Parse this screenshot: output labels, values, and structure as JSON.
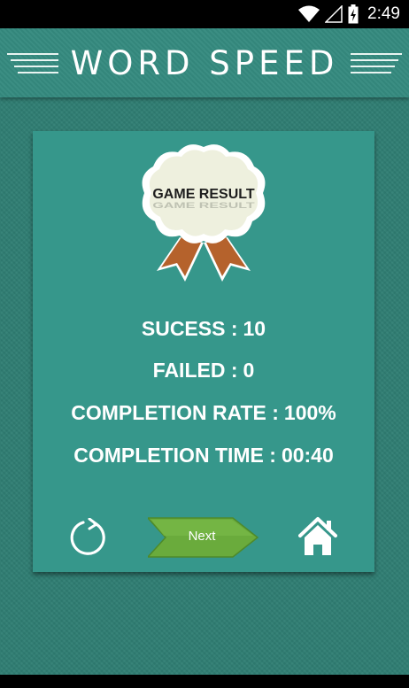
{
  "status_bar": {
    "time": "2:49"
  },
  "header": {
    "title": "WORD SPEED"
  },
  "result": {
    "badge_text": "GAME RESULT",
    "stats": [
      {
        "label": "SUCESS :",
        "value": "10"
      },
      {
        "label": "FAILED :",
        "value": "0"
      },
      {
        "label": "COMPLETION RATE :",
        "value": "100%"
      },
      {
        "label": "COMPLETION TIME :",
        "value": "00:40"
      }
    ]
  },
  "actions": {
    "next_label": "Next",
    "replay_icon": "replay-icon",
    "home_icon": "home-icon"
  },
  "colors": {
    "background": "#2f7e73",
    "card": "#36978b",
    "next_button": "#6aab3c",
    "ribbon": "#b5622c"
  }
}
